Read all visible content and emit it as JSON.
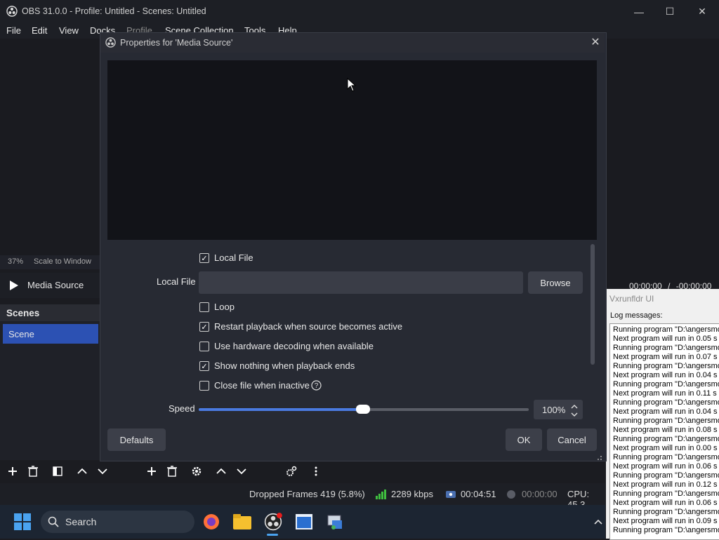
{
  "window": {
    "title": "OBS 31.0.0 - Profile: Untitled - Scenes: Untitled",
    "controls": {
      "minimize": "—",
      "maximize": "☐",
      "close": "✕"
    }
  },
  "menu": [
    "File",
    "Edit",
    "View",
    "Docks",
    "Profile",
    "Scene Collection",
    "Tools",
    "Help"
  ],
  "zoom": {
    "level": "37%",
    "mode": "Scale to Window"
  },
  "source": {
    "name": "Media Source"
  },
  "scenes": {
    "header": "Scenes",
    "items": [
      "Scene"
    ]
  },
  "media_time": {
    "current": "00:00:00",
    "separator": "/",
    "remaining": "-00:00:00"
  },
  "status": {
    "dropped_frames": "Dropped Frames 419 (5.8%)",
    "bitrate": "2289 kbps",
    "stream_time": "00:04:51",
    "record_time": "00:00:00",
    "cpu": "CPU: 45.3"
  },
  "dialog": {
    "title": "Properties for 'Media Source'",
    "local_file_checkbox": {
      "label": "Local File",
      "checked": true
    },
    "local_file_field": {
      "label": "Local File",
      "value": ""
    },
    "browse_label": "Browse",
    "options": [
      {
        "label": "Loop",
        "checked": false
      },
      {
        "label": "Restart playback when source becomes active",
        "checked": true
      },
      {
        "label": "Use hardware decoding when available",
        "checked": false
      },
      {
        "label": "Show nothing when playback ends",
        "checked": true
      },
      {
        "label": "Close file when inactive",
        "checked": false
      }
    ],
    "speed": {
      "label": "Speed",
      "value": "100%",
      "level": 0.5
    },
    "buttons": {
      "defaults": "Defaults",
      "ok": "OK",
      "cancel": "Cancel"
    }
  },
  "vxrunfldr": {
    "title": "Vxrunfldr UI",
    "log_label": "Log messages:",
    "log_lines": [
      "Running program \"D:\\angersmo",
      "Next program will run in 0.05 s",
      "Running program \"D:\\angersmo",
      "Next program will run in 0.07 s",
      "Running program \"D:\\angersmo",
      "Next program will run in 0.04 s",
      "Running program \"D:\\angersmo",
      "Next program will run in 0.11 s",
      "Running program \"D:\\angersmo",
      "Next program will run in 0.04 s",
      "Running program \"D:\\angersmo",
      "Next program will run in 0.08 s",
      "Running program \"D:\\angersmo",
      "Next program will run in 0.00 s",
      "Running program \"D:\\angersmo",
      "Next program will run in 0.06 s",
      "Running program \"D:\\angersmo",
      "Next program will run in 0.12 s",
      "Running program \"D:\\angersmo",
      "Next program will run in 0.06 s",
      "Running program \"D:\\angersmo",
      "Next program will run in 0.09 s",
      "Running program \"D:\\angersmo"
    ]
  },
  "taskbar": {
    "search_placeholder": "Search"
  },
  "colors": {
    "accent": "#2c51b3",
    "slider": "#4a7ae0",
    "signal": "#3fbf3f"
  }
}
